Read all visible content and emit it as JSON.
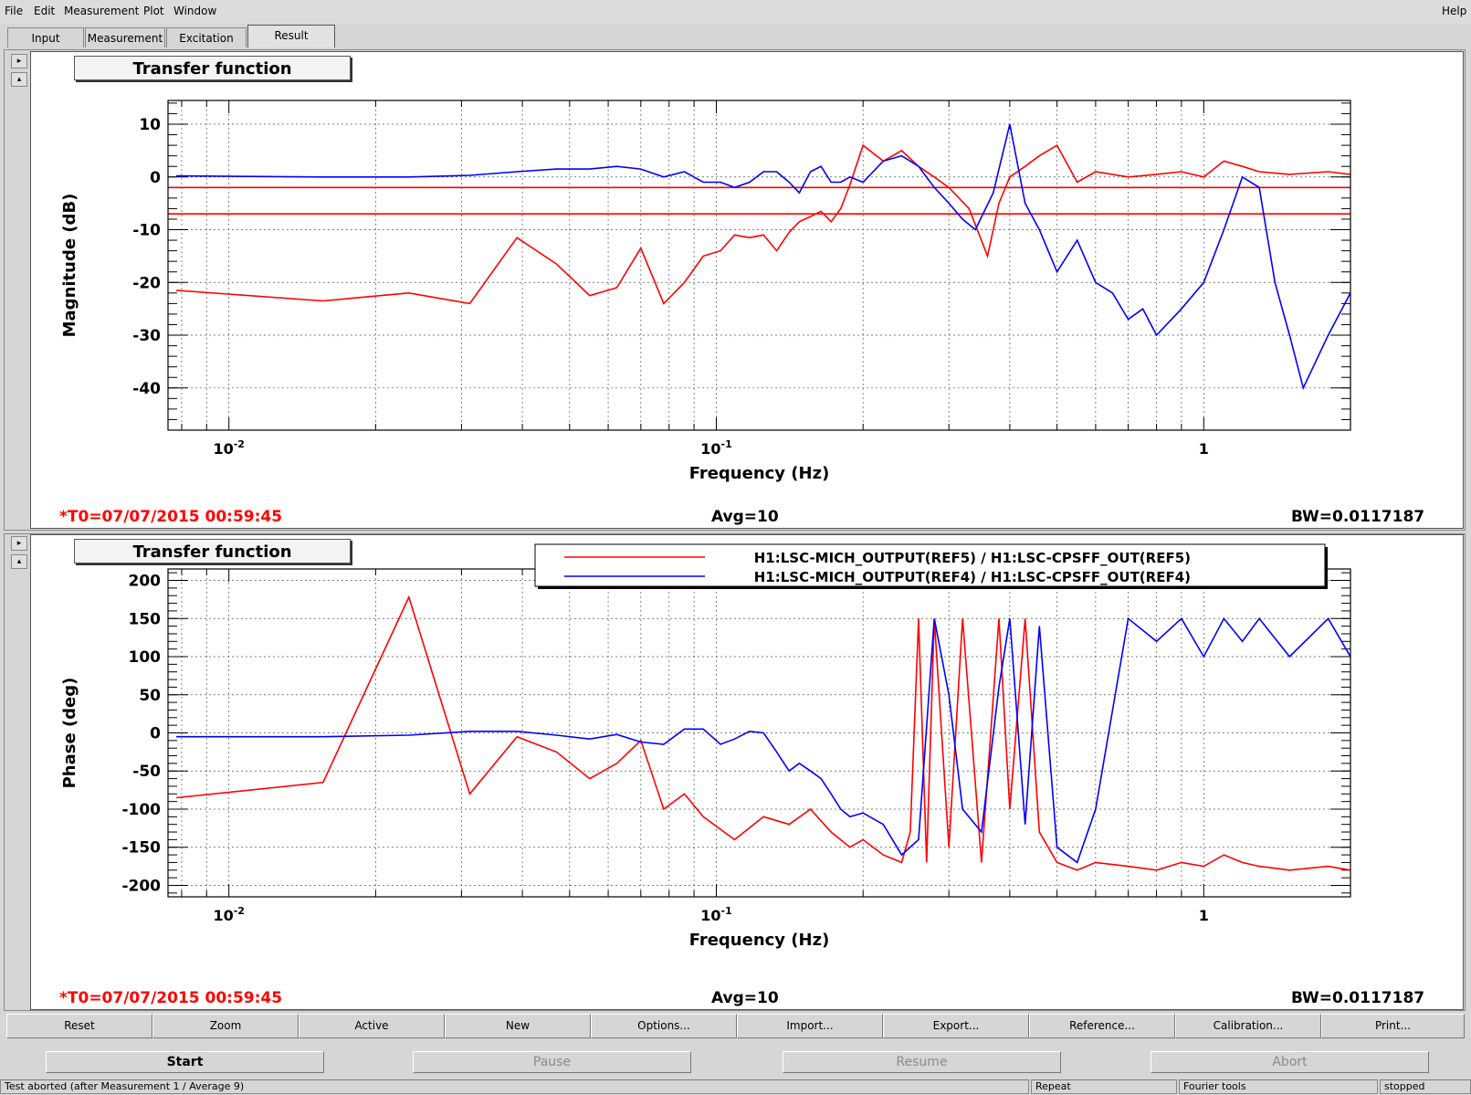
{
  "menu": {
    "items": [
      "File",
      "Edit",
      "Measurement",
      "Plot",
      "Window"
    ],
    "help": "Help"
  },
  "tabs": [
    "Input",
    "Measurement",
    "Excitation",
    "Result"
  ],
  "plots": [
    {
      "title": "Transfer function",
      "stats": {
        "t0": "*T0=07/07/2015 00:59:45",
        "avg": "Avg=10",
        "bw": "BW=0.0117187"
      }
    },
    {
      "title": "Transfer function",
      "stats": {
        "t0": "*T0=07/07/2015 00:59:45",
        "avg": "Avg=10",
        "bw": "BW=0.0117187"
      }
    }
  ],
  "toolbar": [
    "Reset",
    "Zoom",
    "Active",
    "New",
    "Options...",
    "Import...",
    "Export...",
    "Reference...",
    "Calibration...",
    "Print..."
  ],
  "controls": {
    "start": "Start",
    "pause": "Pause",
    "resume": "Resume",
    "abort": "Abort"
  },
  "status": {
    "message": "Test aborted (after Measurement 1 / Average 9)",
    "repeat": "Repeat",
    "fourier": "Fourier tools",
    "state": "stopped"
  },
  "colors": {
    "ref5": "#ff0000",
    "ref4": "#0000ff",
    "timestamp": "#ff0000"
  },
  "chart_data": [
    {
      "type": "line",
      "title": "Transfer function",
      "xlabel": "Frequency (Hz)",
      "ylabel": "Magnitude (dB)",
      "xscale": "log",
      "xlim": [
        0.0075,
        2.0
      ],
      "ylim": [
        -48,
        14.5
      ],
      "xtick_labels": [
        "10^-2",
        "10^-1",
        "1"
      ],
      "ytick_labels": [
        "10",
        "0",
        "-10",
        "-20",
        "-30",
        "-40"
      ],
      "yticks": [
        10,
        0,
        -10,
        -20,
        -30,
        -40
      ],
      "grid": true,
      "hlines": [
        {
          "y": -2,
          "color": "#ff0000"
        },
        {
          "y": -7,
          "color": "#ff0000"
        }
      ],
      "series": [
        {
          "name": "H1:LSC-MICH_OUTPUT(REF5) / H1:LSC-CPSFF_OUT(REF5)",
          "color": "#ff0000",
          "x": [
            0.0078,
            0.0156,
            0.0234,
            0.0312,
            0.039,
            0.047,
            0.055,
            0.0625,
            0.07,
            0.078,
            0.086,
            0.094,
            0.102,
            0.109,
            0.117,
            0.125,
            0.133,
            0.141,
            0.148,
            0.156,
            0.164,
            0.172,
            0.18,
            0.188,
            0.2,
            0.22,
            0.24,
            0.26,
            0.28,
            0.3,
            0.33,
            0.36,
            0.38,
            0.4,
            0.43,
            0.46,
            0.5,
            0.55,
            0.6,
            0.7,
            0.8,
            0.9,
            1.0,
            1.1,
            1.2,
            1.3,
            1.5,
            1.8,
            2.0
          ],
          "y": [
            -21.5,
            -23.5,
            -22,
            -24,
            -11.5,
            -16.5,
            -22.5,
            -21,
            -13.5,
            -24,
            -20,
            -15,
            -14,
            -11,
            -11.5,
            -11,
            -14,
            -10.5,
            -8.5,
            -7.5,
            -6.5,
            -8.5,
            -6,
            -1.5,
            6,
            3,
            5,
            2,
            0,
            -2,
            -6,
            -15,
            -5,
            0,
            2,
            4,
            6,
            -1,
            1,
            0,
            0.5,
            1,
            0,
            3,
            2,
            1,
            0.5,
            1,
            0.5
          ]
        },
        {
          "name": "H1:LSC-MICH_OUTPUT(REF4) / H1:LSC-CPSFF_OUT(REF4)",
          "color": "#0000ff",
          "x": [
            0.0078,
            0.0156,
            0.0234,
            0.0312,
            0.039,
            0.047,
            0.055,
            0.0625,
            0.07,
            0.078,
            0.086,
            0.094,
            0.102,
            0.109,
            0.117,
            0.125,
            0.133,
            0.141,
            0.148,
            0.156,
            0.164,
            0.172,
            0.18,
            0.188,
            0.2,
            0.22,
            0.24,
            0.26,
            0.28,
            0.3,
            0.32,
            0.34,
            0.37,
            0.4,
            0.43,
            0.46,
            0.5,
            0.55,
            0.6,
            0.65,
            0.7,
            0.75,
            0.8,
            0.9,
            1.0,
            1.1,
            1.2,
            1.3,
            1.4,
            1.5,
            1.6,
            1.8,
            2.0
          ],
          "y": [
            0.2,
            0,
            0,
            0.3,
            1,
            1.5,
            1.5,
            2,
            1.5,
            0,
            1,
            -1,
            -1,
            -2,
            -1,
            1,
            1,
            -1,
            -3,
            1,
            2,
            -1,
            -1,
            0,
            -1,
            3,
            4,
            2,
            -2,
            -5,
            -8,
            -10,
            -3,
            10,
            -5,
            -10,
            -18,
            -12,
            -20,
            -22,
            -27,
            -25,
            -30,
            -25,
            -20,
            -10,
            0,
            -2,
            -20,
            -30,
            -40,
            -30,
            -22
          ]
        }
      ]
    },
    {
      "type": "line",
      "title": "Transfer function",
      "xlabel": "Frequency (Hz)",
      "ylabel": "Phase (deg)",
      "xscale": "log",
      "xlim": [
        0.0075,
        2.0
      ],
      "ylim": [
        -215,
        215
      ],
      "xtick_labels": [
        "10^-2",
        "10^-1",
        "1"
      ],
      "ytick_labels": [
        "200",
        "150",
        "100",
        "50",
        "0",
        "-50",
        "-100",
        "-150",
        "-200"
      ],
      "yticks": [
        200,
        150,
        100,
        50,
        0,
        -50,
        -100,
        -150,
        -200
      ],
      "grid": true,
      "legend": "top-right",
      "series": [
        {
          "name": "H1:LSC-MICH_OUTPUT(REF5) / H1:LSC-CPSFF_OUT(REF5)",
          "color": "#ff0000",
          "x": [
            0.0078,
            0.0156,
            0.0234,
            0.0312,
            0.039,
            0.047,
            0.055,
            0.0625,
            0.07,
            0.078,
            0.086,
            0.094,
            0.109,
            0.125,
            0.141,
            0.156,
            0.172,
            0.188,
            0.2,
            0.22,
            0.24,
            0.25,
            0.26,
            0.27,
            0.28,
            0.3,
            0.32,
            0.35,
            0.38,
            0.4,
            0.43,
            0.46,
            0.5,
            0.55,
            0.6,
            0.7,
            0.8,
            0.9,
            1.0,
            1.1,
            1.2,
            1.3,
            1.5,
            1.8,
            2.0
          ],
          "y": [
            -85,
            -65,
            178,
            -80,
            -5,
            -25,
            -60,
            -40,
            -10,
            -100,
            -80,
            -110,
            -140,
            -110,
            -120,
            -100,
            -130,
            -150,
            -140,
            -160,
            -170,
            -130,
            150,
            -170,
            150,
            -150,
            150,
            -170,
            150,
            -100,
            150,
            -130,
            -170,
            -180,
            -170,
            -175,
            -180,
            -170,
            -175,
            -160,
            -170,
            -175,
            -180,
            -175,
            -180
          ]
        },
        {
          "name": "H1:LSC-MICH_OUTPUT(REF4) / H1:LSC-CPSFF_OUT(REF4)",
          "color": "#0000ff",
          "x": [
            0.0078,
            0.0156,
            0.0234,
            0.0312,
            0.039,
            0.047,
            0.055,
            0.0625,
            0.07,
            0.078,
            0.086,
            0.094,
            0.102,
            0.109,
            0.117,
            0.125,
            0.133,
            0.141,
            0.148,
            0.156,
            0.164,
            0.172,
            0.18,
            0.188,
            0.2,
            0.22,
            0.24,
            0.26,
            0.28,
            0.3,
            0.32,
            0.35,
            0.38,
            0.4,
            0.43,
            0.46,
            0.5,
            0.55,
            0.6,
            0.7,
            0.8,
            0.9,
            1.0,
            1.1,
            1.2,
            1.3,
            1.5,
            1.8,
            2.0
          ],
          "y": [
            -5,
            -5,
            -3,
            2,
            2,
            -3,
            -8,
            -2,
            -12,
            -15,
            5,
            5,
            -15,
            -8,
            2,
            0,
            -25,
            -50,
            -40,
            -50,
            -60,
            -80,
            -100,
            -110,
            -105,
            -120,
            -160,
            -140,
            150,
            50,
            -100,
            -130,
            60,
            150,
            -120,
            140,
            -150,
            -170,
            -100,
            150,
            120,
            150,
            100,
            150,
            120,
            150,
            100,
            150,
            100
          ]
        }
      ]
    }
  ]
}
